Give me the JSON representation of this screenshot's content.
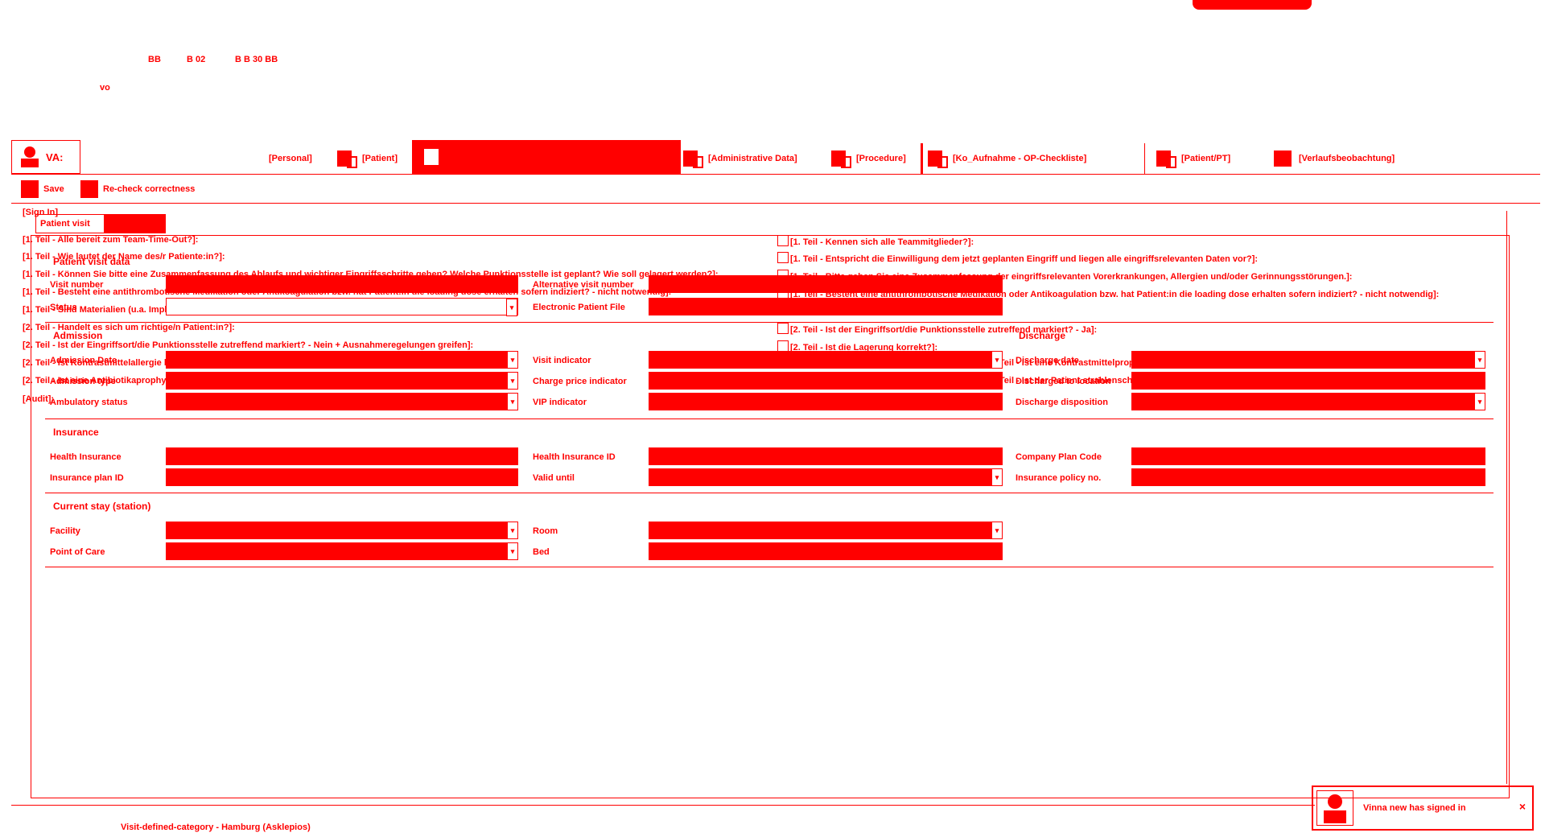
{
  "top_banner": {
    "text_a": "BB",
    "text_b": "B 02",
    "text_c": "B  B 30 BB",
    "text_d": "vo"
  },
  "logo": {
    "label": "VA:"
  },
  "tabs": [
    {
      "label": "[Personal]"
    },
    {
      "label": "[Patient]"
    },
    {
      "label": ""
    },
    {
      "label": "[Administrative Data]"
    },
    {
      "label": "[Procedure]"
    },
    {
      "label": "[Ko_Aufnahme - OP-Checkliste]"
    },
    {
      "label": "[Patient/PT]"
    },
    {
      "label": "[Verlaufsbeobachtung]"
    }
  ],
  "toolbar": {
    "save_label": "Save",
    "check_label": "Re-check correctness"
  },
  "overlay_left": {
    "header": "[Sign In]",
    "items": [
      "[1. Teil - Alle bereit zum Team-Time-Out?]:",
      "[1. Teil - Wie lautet der Name des/r Patiente:in?]:",
      "[1. Teil - Können Sie bitte eine Zusammenfassung des Ablaufs und wichtiger Eingriffsschritte geben? Welche Punktionsstelle ist geplant? Wie soll gelagert werden?]:",
      "[1. Teil - Besteht eine antithrombotische Medikation oder Antikoagulation bzw. hat Patient:in die loading dose erhalten sofern indiziert? - nicht notwendig]:",
      "[1. Teil - Sind Materialien (u.a. Implantate) vollständig und verfügbar (Sterilität, Verfallsdatum, Vollzähligkeit)?]:",
      "[2. Teil - Handelt es sich um richtige/n Patient:in?]:",
      "[2. Teil - Ist der Eingriffsort/die Punktionsstelle zutreffend markiert? - Nein + Ausnahmeregelungen greifen]:",
      "[2. Teil - Ist Kontrastmittelallergie bekannt?]:",
      "[2. Teil - Ist eine Antibiotikaprophylaxe vorgesehen?]:",
      "[Audit]:"
    ]
  },
  "overlay_right": {
    "items": [
      "[1. Teil - Kennen sich alle Teammitglieder?]:",
      "[1. Teil - Entspricht die Einwilligung dem jetzt geplanten Eingriff und liegen alle eingriffsrelevanten Daten vor?]:",
      "[1. Teil - Bitte geben Sie eine Zusammenfassung der eingriffsrelevanten Vorerkrankungen, Allergien und/oder Gerinnungsstörungen.]:",
      "[1. Teil - Besteht eine antithrombotische Medikation oder Antikoagulation bzw. hat Patient:in die loading dose erhalten sofern indiziert? - nicht notwendig]:",
      "",
      "[2. Teil - Ist der Eingriffsort/die Punktionsstelle zutreffend markiert? - Ja]:",
      "[2. Teil - Ist die Lagerung korrekt?]:",
      "[2. Teil - Ist eine Kontrastmittelprophylaxe vorgesehen?]:",
      "[2. Teil - Ist der Patient strahlenschutzgerecht (Schwangerschaft) eingestellt?]:"
    ]
  },
  "panel": {
    "tab_label": "Patient visit",
    "title": "Patient visit data"
  },
  "visit": {
    "visit_number": "Visit number",
    "alt_visit_number": "Alternative visit number",
    "status": "Status",
    "epa": "Electronic Patient File"
  },
  "admission": {
    "title": "Admission",
    "admission_date": "Admission Date",
    "admission_type": "Admission type",
    "ambulatory_status": "Ambulatory status",
    "visit_indicator": "Visit indicator",
    "charge_price": "Charge price indicator",
    "vip": "VIP indicator"
  },
  "discharge": {
    "title": "Discharge",
    "discharge_date": "Discharge date",
    "discharged_to": "Discharged to location",
    "discharge_disposition": "Discharge disposition"
  },
  "insurance": {
    "title": "Insurance",
    "health_insurance": "Health Insurance",
    "plan_id": "Insurance plan ID",
    "health_insurance_id": "Health Insurance ID",
    "valid_until": "Valid until",
    "company_plan": "Company Plan Code",
    "policy_no": "Insurance policy no."
  },
  "stay": {
    "title": "Current stay (station)",
    "facility": "Facility",
    "point_of_care": "Point of Care",
    "room": "Room",
    "bed": "Bed"
  },
  "statusbar": {
    "text": "Visit-defined-category - Hamburg (Asklepios)"
  },
  "toast": {
    "text": "Vinna new has signed in",
    "close": "×"
  }
}
